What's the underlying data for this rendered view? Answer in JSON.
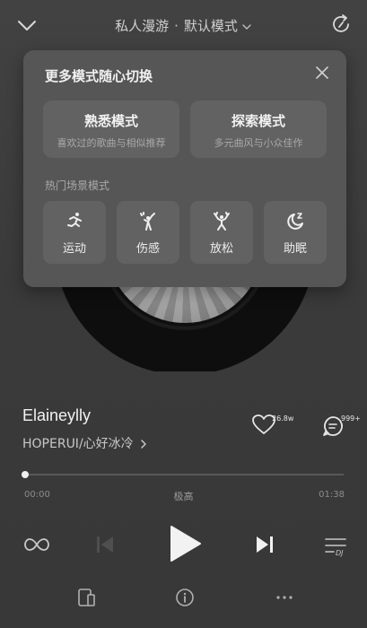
{
  "header": {
    "radio_label": "私人漫游",
    "separator": "·",
    "mode_label": "默认模式"
  },
  "panel": {
    "title": "更多模式随心切换",
    "modes": [
      {
        "title": "熟悉模式",
        "subtitle": "喜欢过的歌曲与相似推荐"
      },
      {
        "title": "探索模式",
        "subtitle": "多元曲风与小众佳作"
      }
    ],
    "scene_title": "热门场景模式",
    "scenes": [
      {
        "label": "运动",
        "icon": "running-icon"
      },
      {
        "label": "伤感",
        "icon": "sad-figure-icon"
      },
      {
        "label": "放松",
        "icon": "relax-figure-icon"
      },
      {
        "label": "助眠",
        "icon": "moon-sleep-icon"
      }
    ]
  },
  "song": {
    "title": "Elaineylly",
    "artist_album": "HOPERUI/心好冰冷",
    "like_count": "26.8w",
    "comment_count": "999+"
  },
  "progress": {
    "current": "00:00",
    "total": "01:38",
    "quality": "极高",
    "fraction": 0.0
  },
  "colors": {
    "background": "#3c3c3c",
    "panel": "#565656",
    "card": "#626262"
  }
}
